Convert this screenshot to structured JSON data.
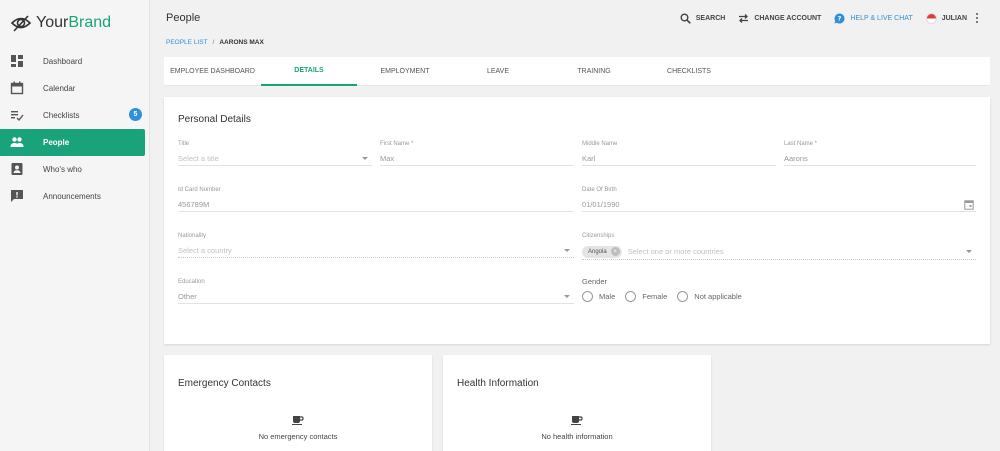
{
  "brand": {
    "name_part1": "Your",
    "name_part2": "Brand"
  },
  "sidebar": {
    "items": [
      {
        "label": "Dashboard",
        "icon": "dashboard-icon"
      },
      {
        "label": "Calendar",
        "icon": "calendar-icon"
      },
      {
        "label": "Checklists",
        "icon": "checklist-icon",
        "badge": "5"
      },
      {
        "label": "People",
        "icon": "people-icon",
        "active": true
      },
      {
        "label": "Who's who",
        "icon": "contact-card-icon"
      },
      {
        "label": "Announcements",
        "icon": "announcement-icon"
      }
    ]
  },
  "header": {
    "title": "People",
    "actions": {
      "search": "SEARCH",
      "change_account": "CHANGE ACCOUNT",
      "help": "HELP & LIVE CHAT",
      "user": "JULIAN"
    }
  },
  "breadcrumb": {
    "parent": "PEOPLE LIST",
    "separator": "/",
    "current": "AARONS MAX"
  },
  "tabs": [
    {
      "label": "EMPLOYEE DASHBOARD"
    },
    {
      "label": "DETAILS",
      "active": true
    },
    {
      "label": "EMPLOYMENT"
    },
    {
      "label": "LEAVE"
    },
    {
      "label": "TRAINING"
    },
    {
      "label": "CHECKLISTS"
    }
  ],
  "personal_details": {
    "title": "Personal Details",
    "title_field": {
      "label": "Title",
      "placeholder": "Select a title"
    },
    "first_name": {
      "label": "First Name *",
      "value": "Max"
    },
    "middle_name": {
      "label": "Middle Name",
      "value": "Karl"
    },
    "last_name": {
      "label": "Last Name *",
      "value": "Aarons"
    },
    "id_card": {
      "label": "Id Card Number",
      "value": "456789M"
    },
    "dob": {
      "label": "Date Of Birth",
      "value": "01/01/1990"
    },
    "nationality": {
      "label": "Nationality",
      "placeholder": "Select a country"
    },
    "citizenships": {
      "label": "Citizenships",
      "chip": "Angola",
      "placeholder": "Select one or more countries"
    },
    "education": {
      "label": "Education",
      "value": "Other"
    },
    "gender": {
      "label": "Gender",
      "options": [
        "Male",
        "Female",
        "Not applicable"
      ]
    }
  },
  "emergency_contacts": {
    "title": "Emergency Contacts",
    "empty": "No emergency contacts"
  },
  "health_information": {
    "title": "Health Information",
    "empty": "No health information"
  },
  "colors": {
    "accent": "#1aa37a",
    "link": "#2f8fd8",
    "badge": "#2f8fd8"
  }
}
